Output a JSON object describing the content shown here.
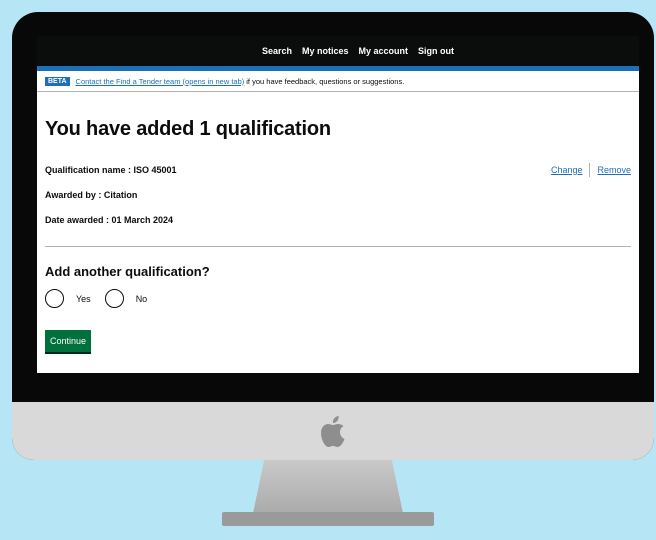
{
  "nav": {
    "items": [
      "Search",
      "My notices",
      "My account",
      "Sign out"
    ]
  },
  "beta": {
    "tag": "BETA",
    "link_text": "Contact the Find a Tender team (opens in new tab)",
    "rest_text": "if you have feedback, questions or suggestions."
  },
  "page": {
    "title": "You have added 1 qualification"
  },
  "summary": {
    "rows": [
      {
        "label": "Qualification name : ISO 45001"
      },
      {
        "label": "Awarded by : Citation"
      },
      {
        "label": "Date awarded : 01 March 2024"
      }
    ],
    "change_label": "Change",
    "remove_label": "Remove"
  },
  "question": {
    "heading": "Add another qualification?",
    "options": [
      "Yes",
      "No"
    ]
  },
  "continue_label": "Continue",
  "colors": {
    "background": "#b6e6f6",
    "link": "#1d70b8",
    "button": "#00703c",
    "nav": "#0b0c0c"
  },
  "icons": {
    "hardware_logo": "apple-logo-icon"
  }
}
